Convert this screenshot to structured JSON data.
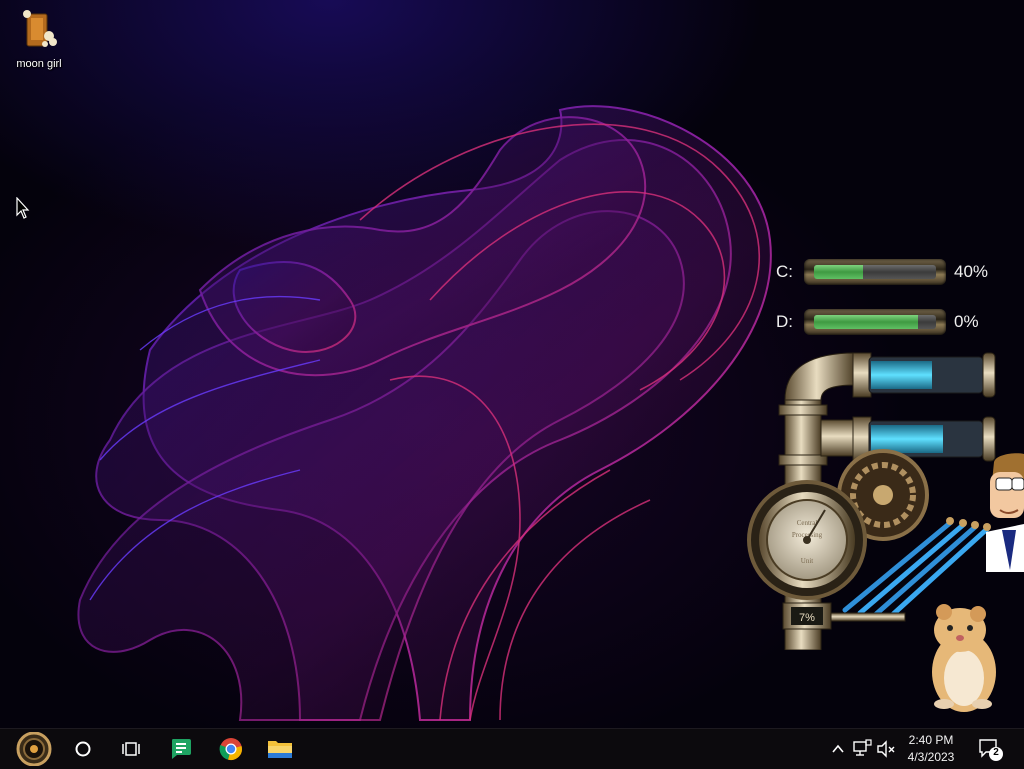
{
  "desktop": {
    "icons": [
      {
        "label": "moon girl",
        "icon": "popcorn-box-icon"
      }
    ]
  },
  "widgets": {
    "drives": [
      {
        "letter": "C:",
        "percent_text": "40%",
        "fill": 0.4
      },
      {
        "letter": "D:",
        "percent_text": "0%",
        "fill": 0.85
      }
    ],
    "cpu_gauge": {
      "percent_text": "7%",
      "dial_text_1": "Central",
      "dial_text_2": "Processing",
      "dial_text_3": "Unit"
    },
    "memory_tubes": [
      {
        "fill": 0.55
      },
      {
        "fill": 0.65
      }
    ]
  },
  "taskbar": {
    "start_icon": "steampunk-start-orb-icon",
    "search_icon": "cortana-circle-icon",
    "task_view_icon": "task-view-icon",
    "pinned": [
      {
        "name": "green-chat-app-icon",
        "color": "#1ea362"
      },
      {
        "name": "chrome-icon",
        "color": "#4285f4"
      },
      {
        "name": "file-explorer-icon",
        "color": "#f3c13a"
      }
    ],
    "tray": {
      "chevron_icon": "chevron-up-icon",
      "network_icon": "network-icon",
      "volume_icon": "volume-muted-icon",
      "time": "2:40 PM",
      "date": "4/3/2023",
      "notifications_icon": "notification-center-icon",
      "notification_count": "2"
    }
  }
}
